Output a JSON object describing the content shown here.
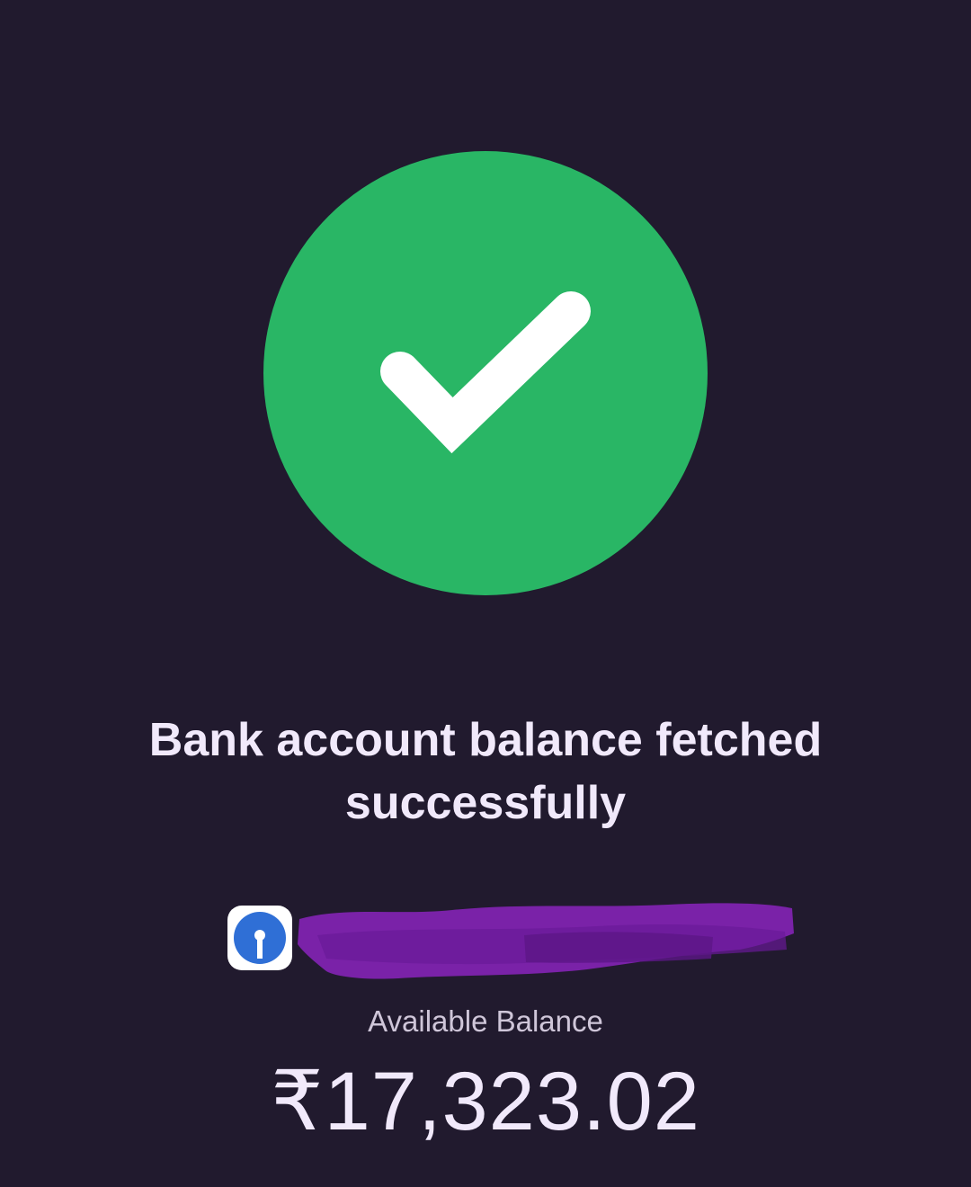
{
  "status": {
    "icon": "check-icon",
    "title": "Bank account balance fetched successfully"
  },
  "account": {
    "bank_logo_icon": "sbi-bank-logo-icon",
    "name_redacted": true
  },
  "balance": {
    "label": "Available Balance",
    "amount": "₹17,323.02"
  },
  "colors": {
    "background": "#211a2e",
    "success_green": "#29b665",
    "text_primary": "#f1e9fb",
    "text_secondary": "#cfc6d9",
    "redaction_purple": "#7a22a8",
    "bank_blue": "#2f6fd6"
  }
}
